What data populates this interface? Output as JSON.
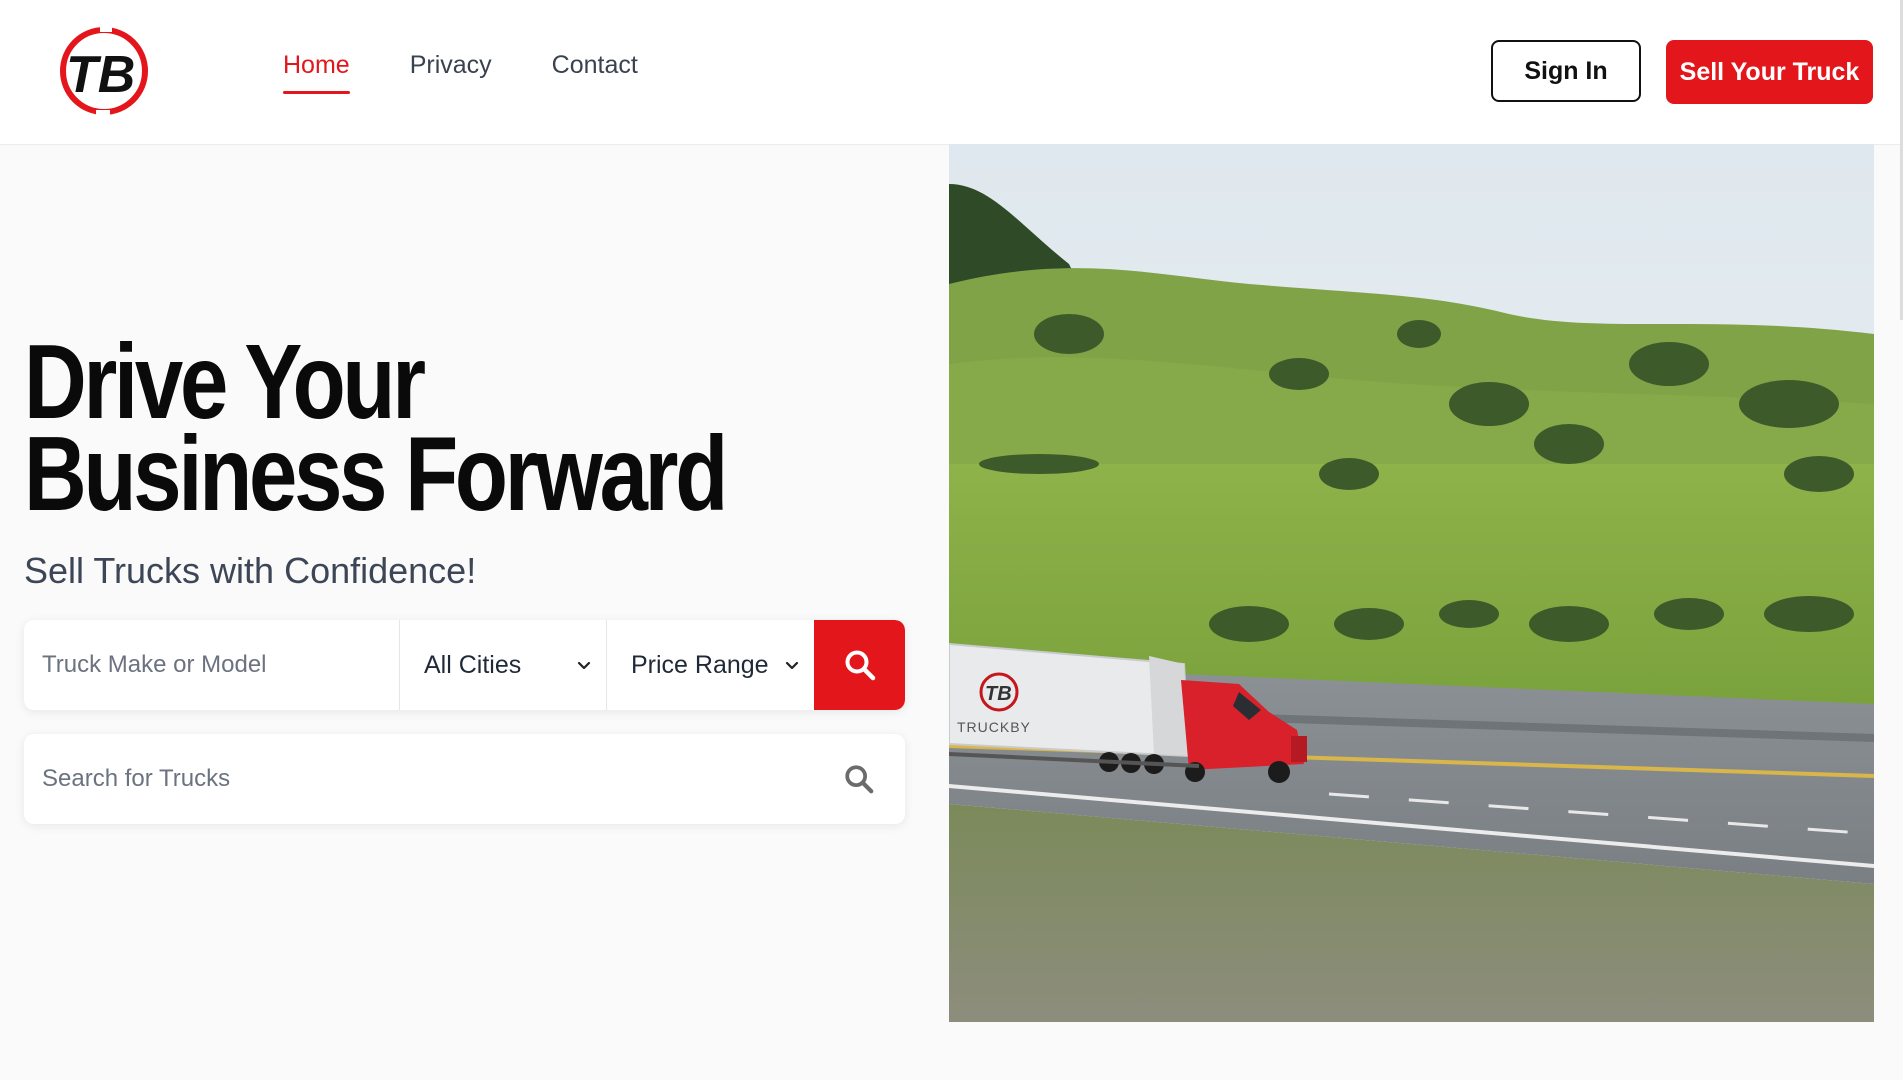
{
  "brand": {
    "logo_letters": "TB",
    "trailer_wordmark": "TRUCKBY"
  },
  "nav": {
    "items": [
      {
        "label": "Home",
        "active": true
      },
      {
        "label": "Privacy",
        "active": false
      },
      {
        "label": "Contact",
        "active": false
      }
    ]
  },
  "header": {
    "sign_in_label": "Sign In",
    "sell_label": "Sell Your Truck"
  },
  "hero": {
    "title_line1": "Drive Your",
    "title_line2": "Business Forward",
    "subtitle": "Sell Trucks with Confidence!"
  },
  "filters": {
    "make_placeholder": "Truck Make or Model",
    "city_value": "All Cities",
    "price_value": "Price Range",
    "submit_icon": "search-icon"
  },
  "search": {
    "placeholder": "Search for Trucks",
    "icon": "search-icon"
  },
  "colors": {
    "accent": "#e3161b",
    "text_dark": "#0a0a0a",
    "text_muted": "#3c4656",
    "page_bg": "#fafafa"
  }
}
